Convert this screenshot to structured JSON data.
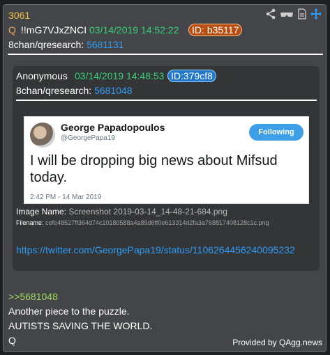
{
  "post": {
    "number": "3061",
    "q_mark": "Q",
    "tripcode": "!!mG7VJxZNCI",
    "date": "03/14/2019 14:52:22",
    "id_badge": "ID: b35117",
    "board": "8chan/qresearch:",
    "board_post": "5681131"
  },
  "quoted": {
    "author": "Anonymous",
    "date": "03/14/2019 14:48:53",
    "id_badge": "ID:379cf8",
    "board": "8chan/qresearch:",
    "board_post": "5681048",
    "tweet": {
      "name": "George Papadopoulos",
      "handle": "@GeorgePapa19",
      "follow_label": "Following",
      "text": "I will be dropping big news about Mifsud today.",
      "time": "2:42 PM - 14 Mar 2019"
    },
    "image_name_label": "Image Name:",
    "image_name": "Screenshot 2019-03-14_14-48-21-684.png",
    "filename_label": "Filename:",
    "filename": "cefe48527ff364d74c10180588a4a89d6ff0e613314d2fa3a768817408128c1c.png",
    "link": "https://twitter.com/GeorgePapa19/status/1106264456240095232"
  },
  "body": {
    "reply_ref": ">>5681048",
    "line1": "Another piece to the puzzle.",
    "line2": "AUTISTS SAVING THE WORLD.",
    "line3": "Q"
  },
  "footer": {
    "provided_by": "Provided by QAgg.news"
  },
  "icons": [
    "share-icon",
    "glasses-icon",
    "document-icon",
    "move-icon"
  ],
  "colors": {
    "post_number": "#f3c246",
    "date": "#36d17a",
    "link": "#2e9bf4",
    "reply_ref": "#9ed85a",
    "id_badge_main": "#b94e12",
    "id_badge_quoted": "#2277c9"
  }
}
